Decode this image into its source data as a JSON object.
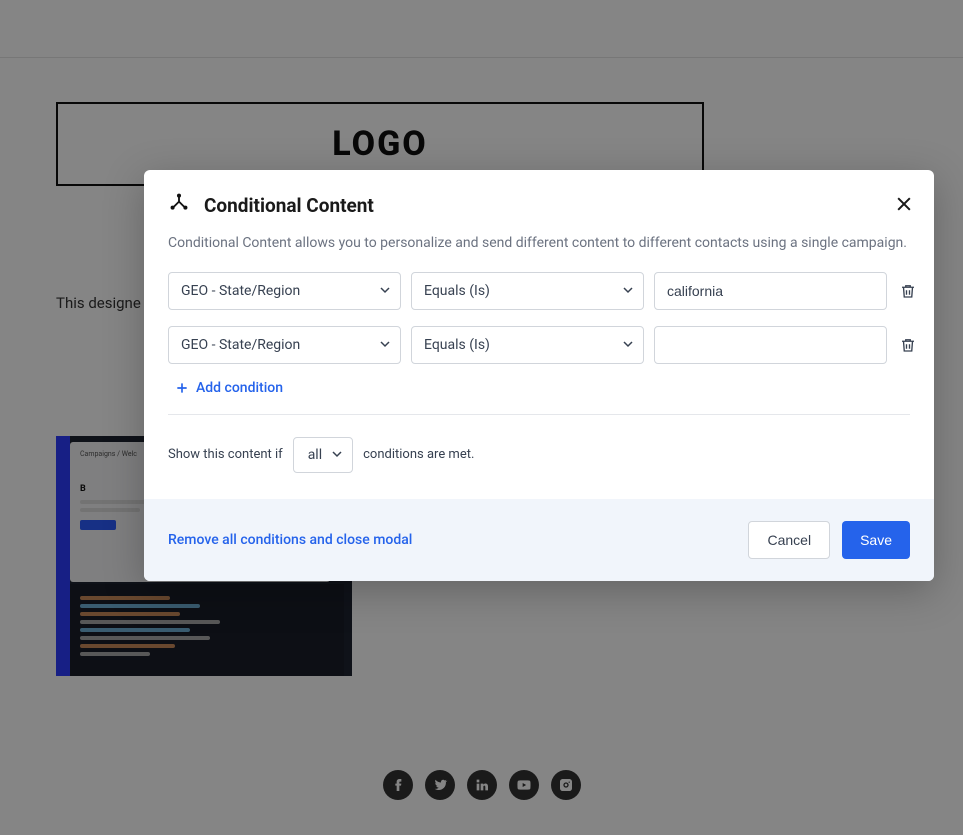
{
  "background": {
    "logo_text": "LOGO",
    "body_text": "This designe",
    "thumbnail_crumb": "Campaigns / Welc"
  },
  "modal": {
    "title": "Conditional Content",
    "description": "Conditional Content allows you to personalize and send different content to different contacts using a single campaign.",
    "conditions": [
      {
        "field": "GEO - State/Region",
        "operator": "Equals (Is)",
        "value": "california"
      },
      {
        "field": "GEO - State/Region",
        "operator": "Equals (Is)",
        "value": ""
      }
    ],
    "add_condition_label": "Add condition",
    "match_prefix": "Show this content if",
    "match_mode": "all",
    "match_suffix": "conditions are met.",
    "remove_all_label": "Remove all conditions and close modal",
    "cancel_label": "Cancel",
    "save_label": "Save"
  }
}
